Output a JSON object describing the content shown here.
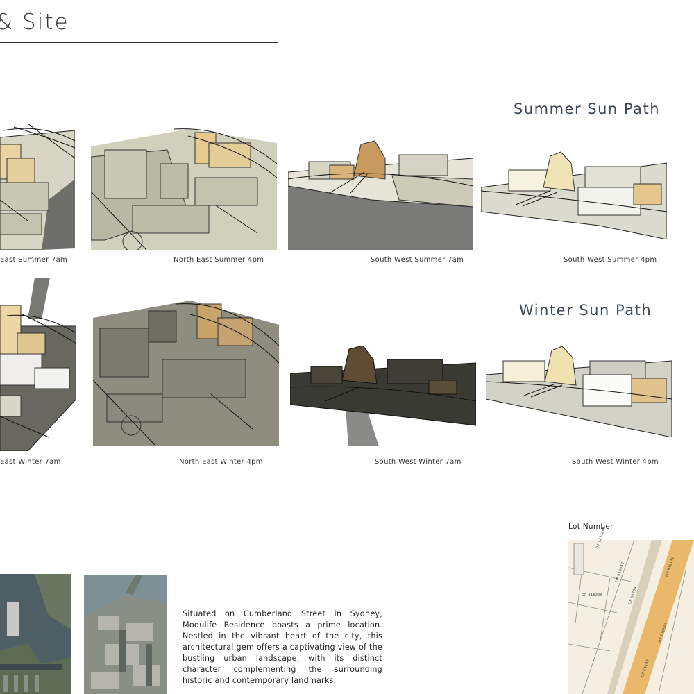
{
  "header": {
    "title": "& Site"
  },
  "summer": {
    "heading": "Summer Sun Path",
    "captions": [
      "East Summer 7am",
      "North East Summer 4pm",
      "South West Summer 7am",
      "South West Summer 4pm"
    ]
  },
  "winter": {
    "heading": "Winter Sun Path",
    "captions": [
      "East Winter 7am",
      "North East Winter 4pm",
      "South West Winter  7am",
      "South West Winter 4pm"
    ]
  },
  "site": {
    "description": "Situated on Cumberland Street in Sydney, Modulife Residence boasts a prime location. Nestled in the vibrant heart of the city, this architectural gem offers a captivating view of the bustling urban landscape, with its distinct character complementing the surrounding historic and contemporary landmarks.",
    "lot_label": "Lot Number",
    "lot_map_labels": [
      "DP 1232205",
      "DP 916442",
      "DP 616206",
      "DP 66464",
      "DP 778674",
      "DP 64448",
      "DP 919146"
    ]
  },
  "colors": {
    "heading": "#3d4a5c",
    "highlight_building": "#e8cf9a",
    "massing": "#c9c7b4",
    "shadow": "#7a7a72"
  }
}
